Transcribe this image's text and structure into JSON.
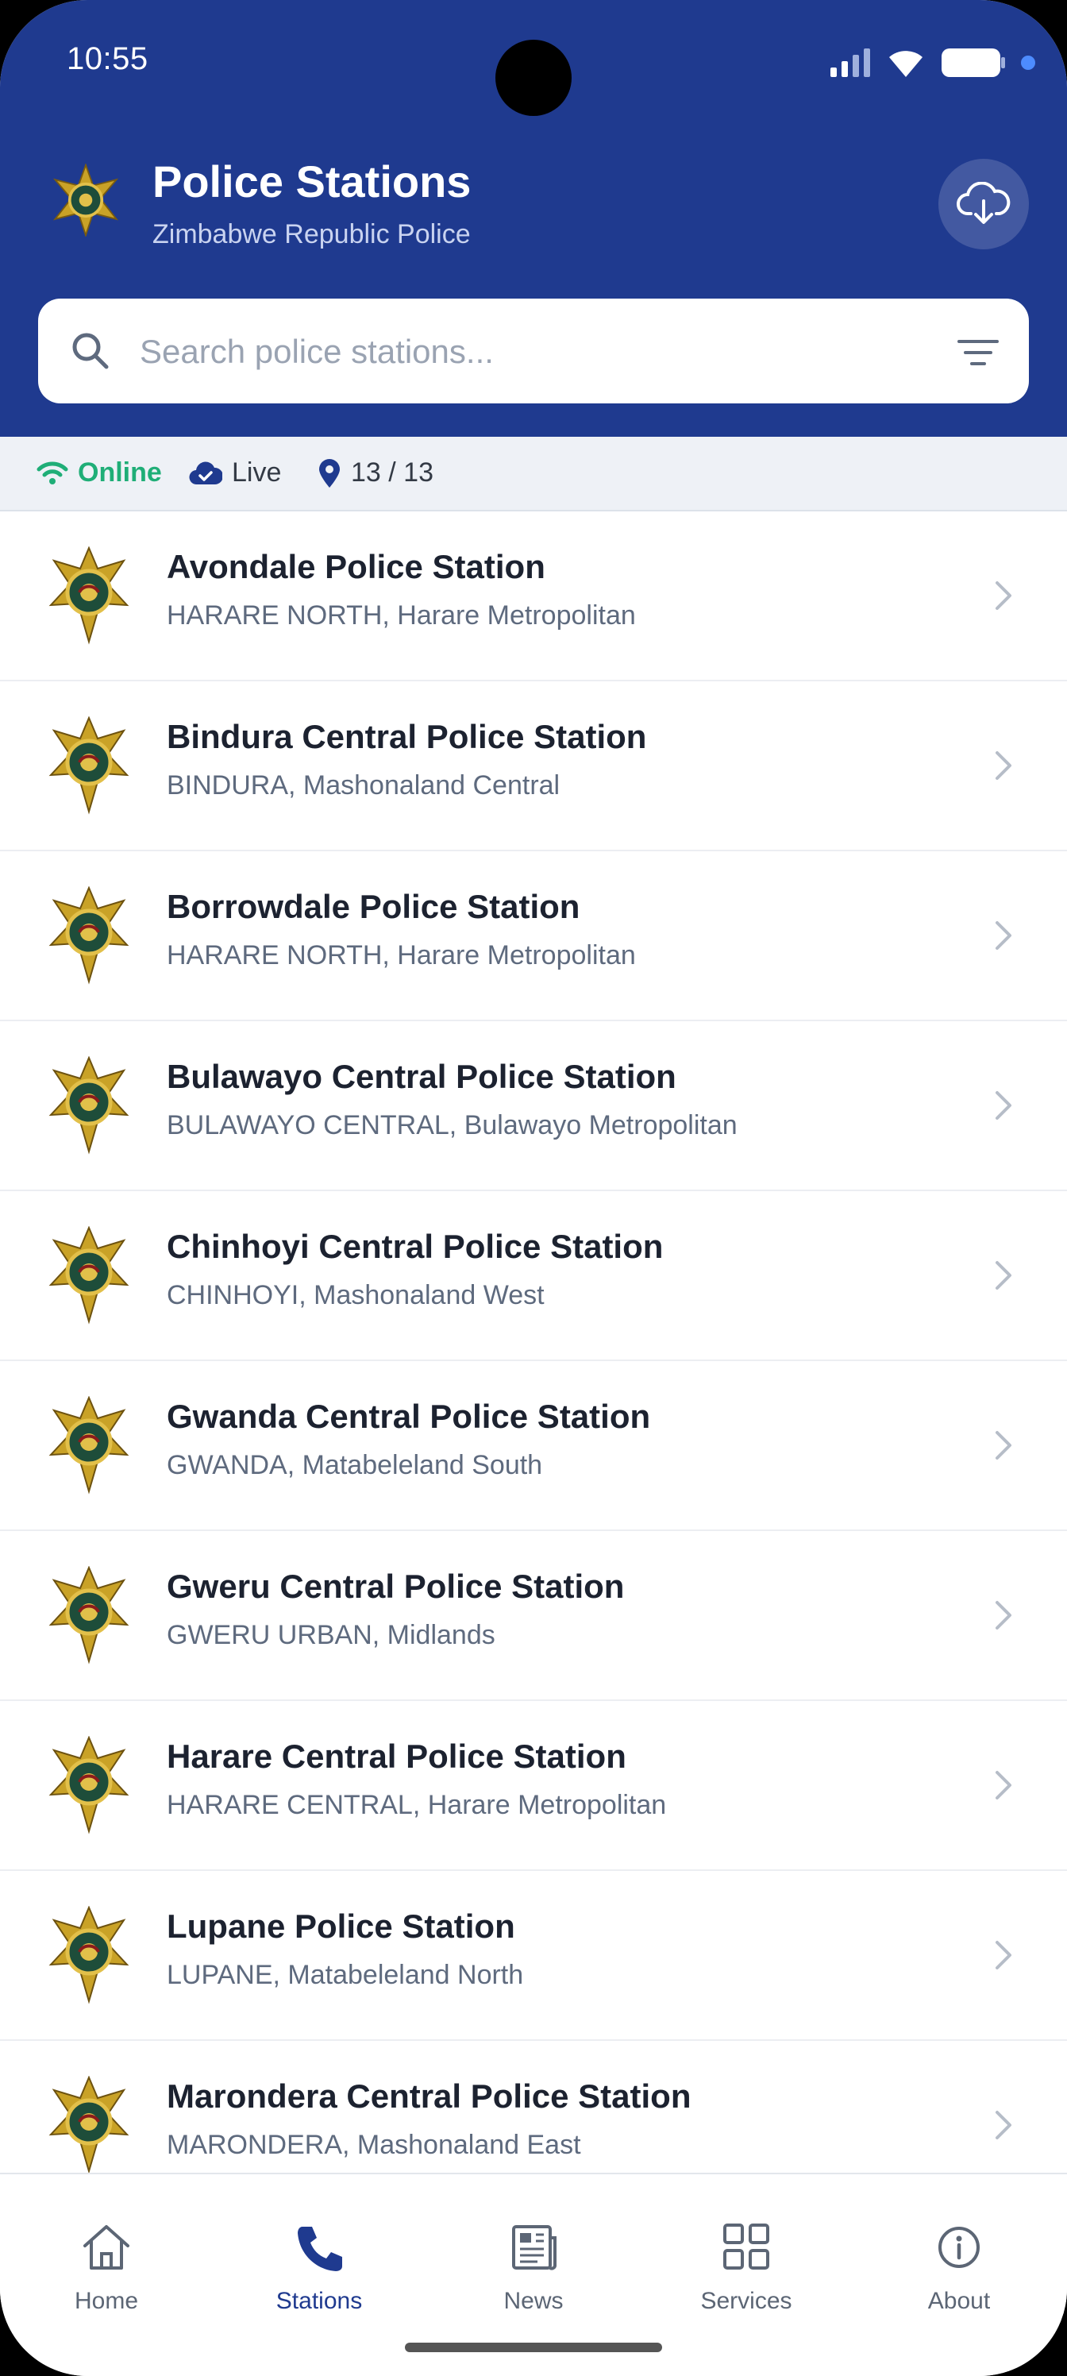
{
  "status_bar": {
    "time": "10:55"
  },
  "header": {
    "title": "Police Stations",
    "subtitle": "Zimbabwe Republic Police",
    "accent_color": "#1f3a8f",
    "action_icon": "cloud-download-icon"
  },
  "search": {
    "placeholder": "Search police stations...",
    "value": ""
  },
  "status_strip": {
    "online_label": "Online",
    "live_label": "Live",
    "count_label": "13 / 13",
    "online_color": "#1fae77"
  },
  "stations": [
    {
      "name": "Avondale Police Station",
      "location": "HARARE NORTH, Harare Metropolitan"
    },
    {
      "name": "Bindura Central Police Station",
      "location": "BINDURA, Mashonaland Central"
    },
    {
      "name": "Borrowdale Police Station",
      "location": "HARARE NORTH, Harare Metropolitan"
    },
    {
      "name": "Bulawayo Central Police Station",
      "location": "BULAWAYO CENTRAL, Bulawayo Metropolitan"
    },
    {
      "name": "Chinhoyi Central Police Station",
      "location": "CHINHOYI, Mashonaland West"
    },
    {
      "name": "Gwanda Central Police Station",
      "location": "GWANDA, Matabeleland South"
    },
    {
      "name": "Gweru Central Police Station",
      "location": "GWERU URBAN, Midlands"
    },
    {
      "name": "Harare Central Police Station",
      "location": "HARARE CENTRAL, Harare Metropolitan"
    },
    {
      "name": "Lupane Police Station",
      "location": "LUPANE, Matabeleland North"
    },
    {
      "name": "Marondera Central Police Station",
      "location": "MARONDERA, Mashonaland East"
    }
  ],
  "bottom_nav": {
    "items": [
      {
        "label": "Home",
        "icon": "home-icon"
      },
      {
        "label": "Stations",
        "icon": "phone-icon",
        "active": true
      },
      {
        "label": "News",
        "icon": "newspaper-icon"
      },
      {
        "label": "Services",
        "icon": "grid-icon"
      },
      {
        "label": "About",
        "icon": "info-icon"
      }
    ]
  }
}
